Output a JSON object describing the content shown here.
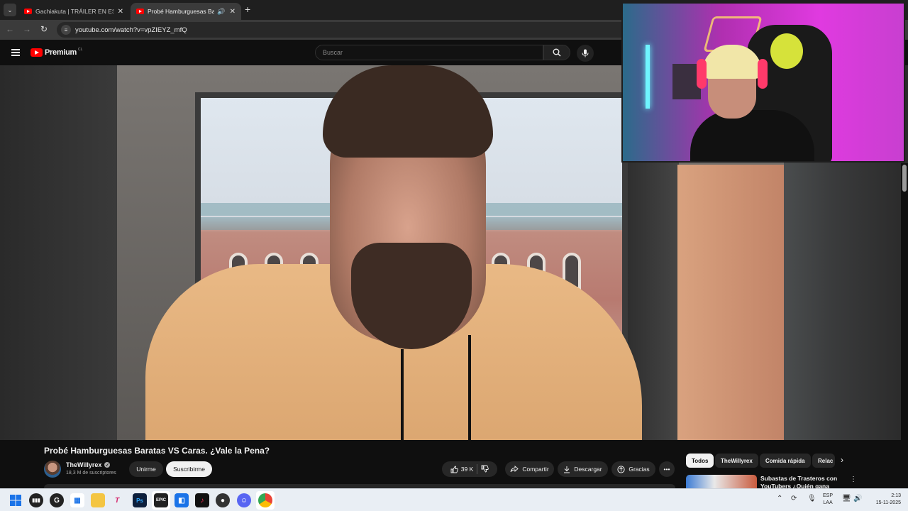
{
  "browser": {
    "tabs": [
      {
        "title": "Gachiakuta | TRÁILER EN ESPAÑ",
        "active": false
      },
      {
        "title": "Probé Hamburguesas Barat",
        "active": true
      }
    ],
    "url": "youtube.com/watch?v=vpZIEYZ_mfQ"
  },
  "youtube": {
    "logo_text": "Premium",
    "logo_country": "CL",
    "search_placeholder": "Buscar"
  },
  "video": {
    "title": "Probé Hamburguesas Baratas VS Caras. ¿Vale la Pena?",
    "channel": "TheWillyrex",
    "subscribers": "18,3 M de suscriptores",
    "join_label": "Unirme",
    "subscribe_label": "Suscribirme",
    "likes": "39 K",
    "share_label": "Compartir",
    "download_label": "Descargar",
    "thanks_label": "Gracias"
  },
  "sidebar": {
    "chips": [
      "Todos",
      "TheWillyrex",
      "Comida rápida",
      "Relac"
    ],
    "related_title": "Subastas de Trasteros con YouTubers ¿Quién gana más?"
  },
  "taskbar": {
    "language": "ESP",
    "region": "LAA",
    "time": "2:13",
    "date": "15-11-2025"
  },
  "colors": {
    "youtube_red": "#ff0000",
    "background": "#0f0f0f",
    "chip_bg": "#272727"
  }
}
